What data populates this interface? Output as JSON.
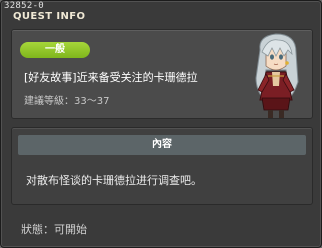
{
  "quest_id": "32852-0",
  "window_title": "QUEST INFO",
  "quest": {
    "category": "一般",
    "name": "[好友故事]近来备受关注的卡珊德拉",
    "recommended_level": "建議等級：33～37"
  },
  "content": {
    "header": "內容",
    "description": "对散布怪谈的卡珊德拉进行调查吧。"
  },
  "status": "狀態：可開始",
  "colors": {
    "window_bg": "#3a3a3a",
    "badge_green": "#8cc526",
    "content_header_bg": "#5c6568"
  },
  "icons": {
    "npc": "npc-portrait-cassandra"
  }
}
